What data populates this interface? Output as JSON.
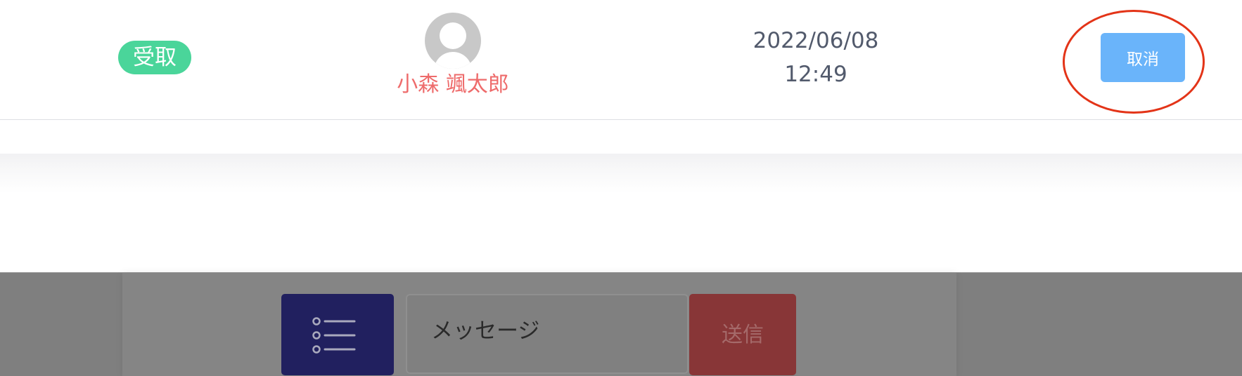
{
  "order_row": {
    "status_label": "受取",
    "user_name": "小森 颯太郎",
    "date": "2022/06/08",
    "time": "12:49",
    "cancel_label": "取消"
  },
  "composer": {
    "menu_icon": "list-icon",
    "message_placeholder": "メッセージ",
    "send_label": "送信"
  },
  "colors": {
    "status_badge": "#4ad59a",
    "user_name": "#ee6b6b",
    "cancel_button": "#6ab4fa",
    "highlight_ring": "#e33418",
    "menu_button": "#21205f",
    "send_button": "#883637"
  }
}
